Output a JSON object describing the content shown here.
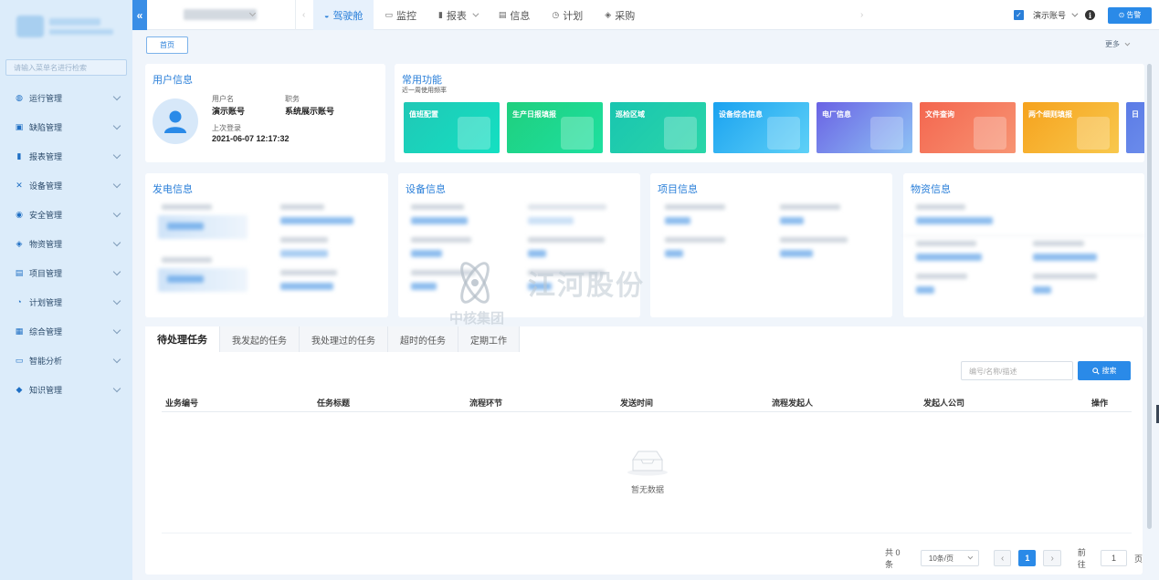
{
  "sidebar": {
    "search_placeholder": "请输入菜单名进行检索",
    "items": [
      {
        "label": "运行管理",
        "icon": "globe-icon"
      },
      {
        "label": "缺陷管理",
        "icon": "wrench-icon"
      },
      {
        "label": "报表管理",
        "icon": "bar-chart-icon"
      },
      {
        "label": "设备管理",
        "icon": "tools-icon"
      },
      {
        "label": "安全管理",
        "icon": "shield-icon"
      },
      {
        "label": "物资管理",
        "icon": "box-icon"
      },
      {
        "label": "项目管理",
        "icon": "folder-icon"
      },
      {
        "label": "计划管理",
        "icon": "pie-chart-icon"
      },
      {
        "label": "综合管理",
        "icon": "grid-icon"
      },
      {
        "label": "智能分析",
        "icon": "monitor-icon"
      },
      {
        "label": "知识管理",
        "icon": "layers-icon"
      }
    ]
  },
  "topnav": {
    "tabs": [
      {
        "label": "驾驶舱",
        "icon": "dashboard-icon",
        "active": true
      },
      {
        "label": "监控",
        "icon": "monitor-icon"
      },
      {
        "label": "报表",
        "icon": "bar-chart-icon",
        "has_caret": true
      },
      {
        "label": "信息",
        "icon": "document-icon"
      },
      {
        "label": "计划",
        "icon": "clock-icon"
      },
      {
        "label": "采购",
        "icon": "cube-icon"
      }
    ],
    "account": "演示账号",
    "alarm_label": "告警"
  },
  "breadcrumb": {
    "home": "首页",
    "more": "更多"
  },
  "user_info": {
    "title": "用户信息",
    "username_label": "用户名",
    "username": "演示账号",
    "position_label": "职务",
    "position": "系统展示账号",
    "last_login_label": "上次登录",
    "last_login": "2021-06-07 12:17:32"
  },
  "functions": {
    "title": "常用功能",
    "subtitle": "近一周使用频率",
    "tiles": [
      {
        "label": "值班配置",
        "from": "#20c8b6",
        "to": "#14e0c2"
      },
      {
        "label": "生产日报填报",
        "from": "#1fcf7e",
        "to": "#1ee0a0"
      },
      {
        "label": "巡检区域",
        "from": "#19c5b0",
        "to": "#2ad6a8"
      },
      {
        "label": "设备综合信息",
        "from": "#1aa2f0",
        "to": "#5fd1f7"
      },
      {
        "label": "电厂信息",
        "from": "#6a62e4",
        "to": "#8ec3f5"
      },
      {
        "label": "文件查询",
        "from": "#f4664f",
        "to": "#f79473"
      },
      {
        "label": "两个细则填报",
        "from": "#f6a21d",
        "to": "#f8c84d"
      },
      {
        "label": "日",
        "from": "#5b7be6",
        "to": "#7c9ef0"
      }
    ]
  },
  "power_info": {
    "title": "发电信息"
  },
  "device_info": {
    "title": "设备信息"
  },
  "project_info": {
    "title": "项目信息"
  },
  "material_info": {
    "title": "物资信息"
  },
  "watermark": {
    "brand": "江河股份",
    "group": "中核集团"
  },
  "tasks": {
    "tabs": [
      "待处理任务",
      "我发起的任务",
      "我处理过的任务",
      "超时的任务",
      "定期工作"
    ],
    "search_placeholder": "编号/名称/描述",
    "search_button": "搜索",
    "columns": [
      "业务编号",
      "任务标题",
      "流程环节",
      "发送时间",
      "流程发起人",
      "发起人公司",
      "操作"
    ],
    "empty_text": "暂无数据",
    "pager": {
      "total": "共 0 条",
      "page_size": "10条/页",
      "current": "1",
      "goto_label": "前往",
      "goto_value": "1",
      "page_suffix": "页"
    }
  }
}
